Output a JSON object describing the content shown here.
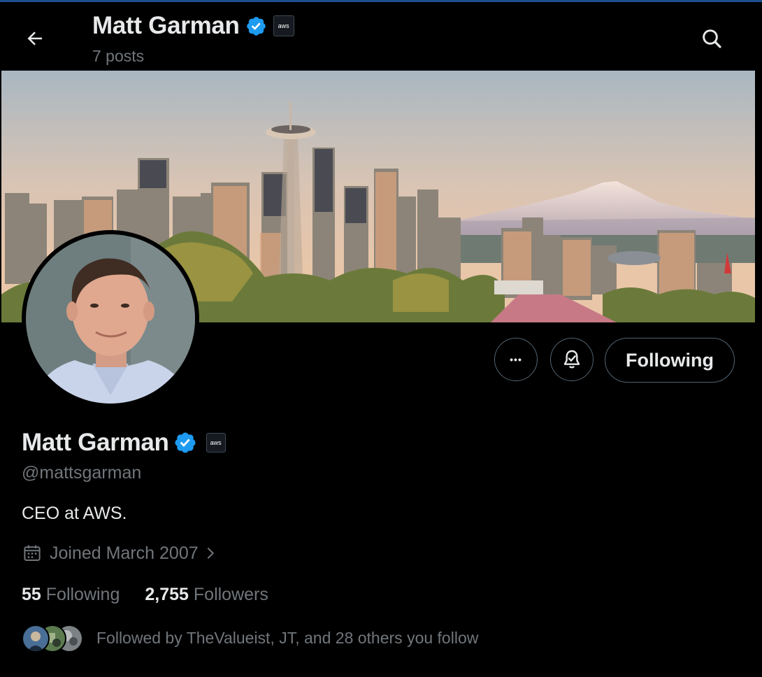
{
  "header": {
    "name": "Matt Garman",
    "posts": "7 posts",
    "aws_badge": "aws"
  },
  "profile": {
    "name": "Matt Garman",
    "handle": "@mattsgarman",
    "bio": "CEO at AWS.",
    "joined": "Joined March 2007",
    "aws_badge": "aws"
  },
  "actions": {
    "more_label": "•••",
    "following_label": "Following"
  },
  "stats": {
    "following_count": "55",
    "following_label": "Following",
    "followers_count": "2,755",
    "followers_label": "Followers"
  },
  "followed_by": "Followed by TheValueist, JT, and 28 others you follow",
  "icons": {
    "back": "arrow-left-icon",
    "search": "search-icon",
    "verified": "verified-badge-icon",
    "calendar": "calendar-icon",
    "notify": "bell-icon",
    "more": "more-icon"
  },
  "colors": {
    "verified_blue": "#1d9bf0",
    "text_primary": "#e7e9ea",
    "text_secondary": "#71767b",
    "background": "#000000"
  }
}
